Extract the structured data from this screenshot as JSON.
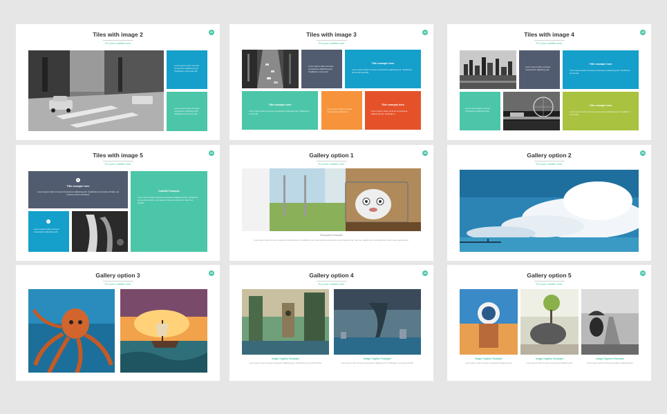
{
  "slides": {
    "s1": {
      "title": "Tiles with image 2",
      "subtitle": "Put your subtitle here",
      "num": "21",
      "tile1_text": "Lorem ipsum dolor sit amet consectetur adipiscing elit. Vestibulum commodo elit.",
      "tile2_text": "Lorem ipsum dolor sit amet consectetur adipiscing elit. Vestibulum commodo elit."
    },
    "s2": {
      "title": "Tiles with image 3",
      "subtitle": "Put your subtitle here",
      "num": "22",
      "tile_slate_text": "Lorem ipsum dolor sit amet consectetur adipiscing elit. Vestibulum commodo.",
      "tile_blue_title": "Title example here",
      "tile_blue_text": "Lorem ipsum dolor sit amet consectetur adipiscing elit. Vestibulum commodo elit felis.",
      "tile_teal_title": "Title example here",
      "tile_teal_text": "Lorem ipsum dolor sit amet consectetur adipiscing elit. Vestibulum commodo.",
      "tile_orange_text": "Lorem ipsum dolor sit amet consectetur adipiscing.",
      "tile_red_title": "Title example here",
      "tile_red_text": "Lorem ipsum dolor sit amet consectetur adipiscing elit. Vestibulum."
    },
    "s3": {
      "title": "Tiles with image 4",
      "subtitle": "Put your subtitle here",
      "num": "23",
      "tile_slate_text": "Lorem ipsum dolor sit amet consectetur adipiscing elit.",
      "tile_blue_title": "Title example here",
      "tile_blue_text": "Lorem ipsum dolor sit amet consectetur adipiscing elit. Vestibulum commodo.",
      "tile_teal_text": "Lorem ipsum dolor sit amet consectetur adipiscing elit.",
      "tile_green_title": "Title example here",
      "tile_green_text": "Lorem ipsum dolor sit amet consectetur adipiscing elit. Vestibulum commodo."
    },
    "s4": {
      "title": "Tiles with image 5",
      "subtitle": "Put your subtitle here",
      "num": "24",
      "slate_title": "Title example here",
      "slate_text": "Lorem ipsum dolor sit amet consectetur adipiscing elit. Vestibulum commodo elit felis, vel maximus lorem hendrerit.",
      "teal_title": "Subtitle Example",
      "teal_text": "Lorem ipsum dolor sit amet consectetur adipiscing elit. Vestibulum commodo elit felis, vel maximus lorem hendrerit at. Nam nec sagittis.",
      "blue_text": "Lorem ipsum dolor sit amet consectetur adipiscing elit."
    },
    "s5": {
      "title": "Gallery option 1",
      "subtitle": "Put your subtitle here",
      "num": "25",
      "caption": "Description Example",
      "caption_text": "Lorem ipsum dolor sit amet consectetur adipiscing elit. Vestibulum commodo elit felis vel maximus lorem hendrerit at. Nam nec sagittis urna. Sed dignissim viverra risus eget pretium."
    },
    "s6": {
      "title": "Gallery option 2",
      "subtitle": "Put your subtitle here",
      "num": "26"
    },
    "s7": {
      "title": "Gallery option 3",
      "subtitle": "Put your subtitle here",
      "num": "26"
    },
    "s8": {
      "title": "Gallery option 4",
      "subtitle": "Put your subtitle here",
      "num": "28",
      "cap1": "Image Caption Example",
      "cap1_text": "Lorem ipsum dolor sit amet consectetur adipiscing elit. Vestibulum commodo elit felis.",
      "cap2": "Image Caption Example",
      "cap2_text": "Lorem ipsum dolor sit amet consectetur adipiscing elit. Vestibulum commodo elit felis."
    },
    "s9": {
      "title": "Gallery option 5",
      "subtitle": "Put your subtitle here",
      "num": "29",
      "cap1": "Image Caption Example",
      "cap1_text": "Lorem ipsum dolor sit amet consectetur adipiscing elit.",
      "cap2": "Image Caption Example",
      "cap2_text": "Lorem ipsum dolor sit amet consectetur adipiscing elit.",
      "cap3": "Image Caption Example",
      "cap3_text": "Lorem ipsum dolor sit amet consectetur adipiscing elit."
    }
  },
  "colors": {
    "teal": "#4cc6a8",
    "blue": "#159fcb",
    "slate": "#525c70",
    "orange": "#f7933a",
    "red": "#e5522a",
    "green": "#a9c23f",
    "background": "#e6e6e6"
  }
}
